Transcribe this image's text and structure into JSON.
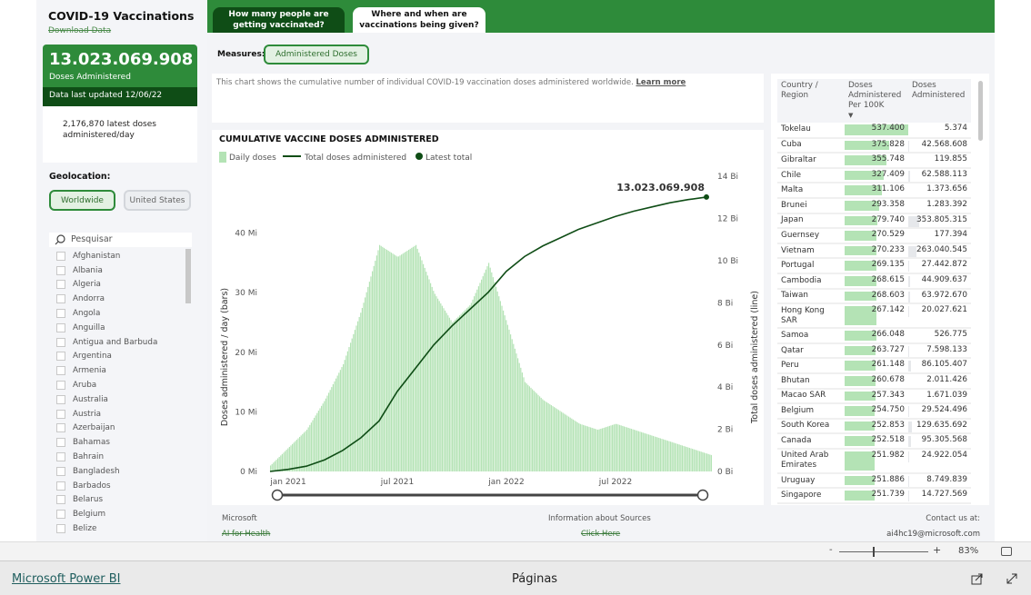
{
  "sidebar": {
    "title": "COVID-19 Vaccinations",
    "download": "Download Data",
    "kpi_value": "13.023.069.908",
    "kpi_label": "Doses Administered",
    "updated": "Data last updated 12/06/22",
    "latest": "2,176,870 latest doses administered/day",
    "geo_label": "Geolocation:",
    "geo_options": [
      "Worldwide",
      "United States"
    ],
    "geo_selected": "Worldwide",
    "search_placeholder": "Pesquisar",
    "search_icon": "search-icon",
    "countries": [
      "Afghanistan",
      "Albania",
      "Algeria",
      "Andorra",
      "Angola",
      "Anguilla",
      "Antigua and Barbuda",
      "Argentina",
      "Armenia",
      "Aruba",
      "Australia",
      "Austria",
      "Azerbaijan",
      "Bahamas",
      "Bahrain",
      "Bangladesh",
      "Barbados",
      "Belarus",
      "Belgium",
      "Belize"
    ]
  },
  "tabs": [
    {
      "label": "How many people are getting vaccinated?",
      "active": false
    },
    {
      "label": "Where and when are vaccinations being given?",
      "active": true
    }
  ],
  "measures": {
    "label": "Measures:",
    "selected": "Administered Doses"
  },
  "description": {
    "text": "This chart shows the cumulative number of individual COVID-19 vaccination doses administered worldwide.",
    "link": "Learn more"
  },
  "chart_data": {
    "type": "bar+line",
    "title": "CUMULATIVE VACCINE DOSES ADMINISTERED",
    "legend": [
      "Daily doses",
      "Total doses administered",
      "Latest total"
    ],
    "legend_position": "top-left",
    "ylabel_left": "Doses administered / day (bars)",
    "ylabel_right": "Total doses administered (line)",
    "x_ticks": [
      "jan 2021",
      "jul 2021",
      "jan 2022",
      "jul 2022"
    ],
    "y_left_ticks": [
      "0 Mi",
      "10 Mi",
      "20 Mi",
      "30 Mi",
      "40 Mi"
    ],
    "ylim_left": [
      0,
      50
    ],
    "y_right_ticks": [
      "0 Bi",
      "2 Bi",
      "4 Bi",
      "6 Bi",
      "8 Bi",
      "10 Bi",
      "12 Bi",
      "14 Bi"
    ],
    "ylim_right": [
      0,
      14
    ],
    "months": [
      "2020-12",
      "2021-01",
      "2021-02",
      "2021-03",
      "2021-04",
      "2021-05",
      "2021-06",
      "2021-07",
      "2021-08",
      "2021-09",
      "2021-10",
      "2021-11",
      "2021-12",
      "2022-01",
      "2022-02",
      "2022-03",
      "2022-04",
      "2022-05",
      "2022-06",
      "2022-07",
      "2022-08",
      "2022-09",
      "2022-10",
      "2022-11",
      "2022-12"
    ],
    "daily_mi": [
      1,
      4,
      7,
      12,
      18,
      27,
      38,
      36,
      38,
      30,
      25,
      28,
      35,
      25,
      15,
      12,
      10,
      8,
      7,
      8,
      7,
      6,
      5,
      4,
      3
    ],
    "total_bi": [
      0,
      0.1,
      0.25,
      0.55,
      1.0,
      1.6,
      2.4,
      3.8,
      4.9,
      6.0,
      6.9,
      7.7,
      8.5,
      9.5,
      10.2,
      10.7,
      11.1,
      11.5,
      11.8,
      12.1,
      12.35,
      12.55,
      12.75,
      12.9,
      13.02
    ],
    "latest_label": "13.023.069.908",
    "colors": {
      "bars": "#b4e3b5",
      "line": "#0f4d16"
    }
  },
  "table": {
    "headers": [
      "Country / Region",
      "Doses Administered Per 100K",
      "Doses Administered"
    ],
    "sort": "desc",
    "rows": [
      [
        "Tokelau",
        "537.400",
        "5.374"
      ],
      [
        "Cuba",
        "375.828",
        "42.568.608"
      ],
      [
        "Gibraltar",
        "355.748",
        "119.855"
      ],
      [
        "Chile",
        "327.409",
        "62.588.113"
      ],
      [
        "Malta",
        "311.106",
        "1.373.656"
      ],
      [
        "Brunei",
        "293.358",
        "1.283.392"
      ],
      [
        "Japan",
        "279.740",
        "353.805.315"
      ],
      [
        "Guernsey",
        "270.529",
        "177.394"
      ],
      [
        "Vietnam",
        "270.233",
        "263.040.545"
      ],
      [
        "Portugal",
        "269.135",
        "27.442.872"
      ],
      [
        "Cambodia",
        "268.615",
        "44.909.637"
      ],
      [
        "Taiwan",
        "268.603",
        "63.972.670"
      ],
      [
        "Hong Kong SAR",
        "267.142",
        "20.027.621"
      ],
      [
        "Samoa",
        "266.048",
        "526.775"
      ],
      [
        "Qatar",
        "263.727",
        "7.598.133"
      ],
      [
        "Peru",
        "261.148",
        "86.105.407"
      ],
      [
        "Bhutan",
        "260.678",
        "2.011.426"
      ],
      [
        "Macao SAR",
        "257.343",
        "1.671.039"
      ],
      [
        "Belgium",
        "254.750",
        "29.524.496"
      ],
      [
        "South Korea",
        "252.853",
        "129.635.692"
      ],
      [
        "Canada",
        "252.518",
        "95.305.568"
      ],
      [
        "United Arab Emirates",
        "251.982",
        "24.922.054"
      ],
      [
        "Uruguay",
        "251.886",
        "8.749.839"
      ],
      [
        "Singapore",
        "251.739",
        "14.727.569"
      ]
    ]
  },
  "footer": {
    "left_title": "Microsoft",
    "left_link": "AI for Health",
    "mid_title": "Information about Sources",
    "mid_link": "Click Here",
    "right_title": "Contact us at:",
    "right_link": "ai4hc19@microsoft.com"
  },
  "status": {
    "zoom_minus": "-",
    "zoom_plus": "+",
    "zoom": "83%",
    "zoom_level_percent": 83
  },
  "bottom": {
    "brand": "Microsoft Power BI",
    "pages": "Páginas",
    "colors": {
      "accent": "#2e8b3a",
      "dark": "#0f4d16"
    }
  }
}
